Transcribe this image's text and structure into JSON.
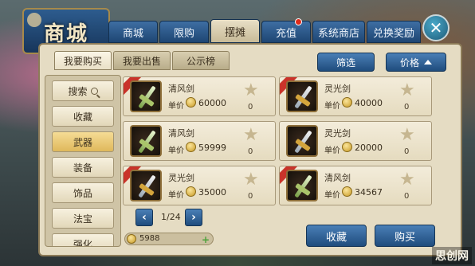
{
  "logo": {
    "text": "商城"
  },
  "tabs": [
    {
      "label": "商城",
      "active": false,
      "badge": false
    },
    {
      "label": "限购",
      "active": false,
      "badge": false
    },
    {
      "label": "摆摊",
      "active": true,
      "badge": false
    },
    {
      "label": "充值",
      "active": false,
      "badge": true
    },
    {
      "label": "系统商店",
      "active": false,
      "badge": false
    },
    {
      "label": "兑换奖励",
      "active": false,
      "badge": false
    }
  ],
  "subtabs": [
    {
      "label": "我要购买",
      "active": true
    },
    {
      "label": "我要出售",
      "active": false
    },
    {
      "label": "公示榜",
      "active": false
    }
  ],
  "toolbar": {
    "filter_label": "筛选",
    "price_label": "价格"
  },
  "menu": [
    {
      "label": "搜索",
      "active": false,
      "icon": "search-icon"
    },
    {
      "label": "收藏",
      "active": false
    },
    {
      "label": "武器",
      "active": true
    },
    {
      "label": "装备",
      "active": false
    },
    {
      "label": "饰品",
      "active": false
    },
    {
      "label": "法宝",
      "active": false
    },
    {
      "label": "强化",
      "active": false
    }
  ],
  "price_prefix": "单价",
  "items": [
    {
      "name": "清风剑",
      "price": "60000",
      "favorites": "0",
      "style": "green"
    },
    {
      "name": "灵光剑",
      "price": "40000",
      "favorites": "0",
      "style": "gold"
    },
    {
      "name": "清风剑",
      "price": "59999",
      "favorites": "0",
      "style": "green"
    },
    {
      "name": "灵光剑",
      "price": "20000",
      "favorites": "0",
      "style": "gold"
    },
    {
      "name": "灵光剑",
      "price": "35000",
      "favorites": "0",
      "style": "gold"
    },
    {
      "name": "清风剑",
      "price": "34567",
      "favorites": "0",
      "style": "green"
    }
  ],
  "pagination": {
    "text": "1/24"
  },
  "currency": {
    "value": "5988"
  },
  "actions": {
    "favorite_label": "收藏",
    "buy_label": "购买"
  },
  "watermark": {
    "text": "思创网"
  },
  "colors": {
    "accent_blue": "#1f4c7d",
    "panel_bg": "#e5dcc3",
    "active_gold": "#dfb85b"
  }
}
